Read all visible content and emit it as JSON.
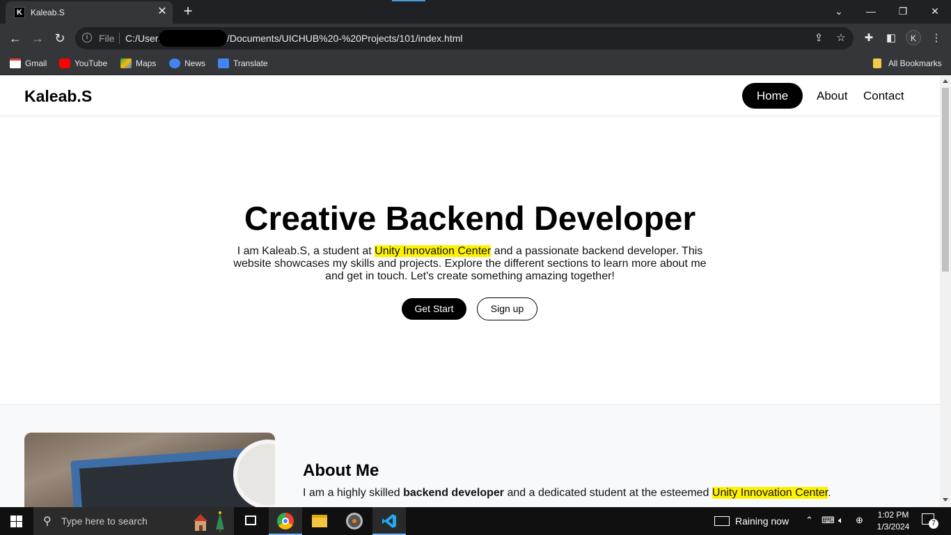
{
  "browser": {
    "tab_title": "Kaleab.S",
    "tab_favicon_letter": "K",
    "address": {
      "scheme_label": "File",
      "url_prefix": "C:/Users",
      "url_suffix": "/Documents/UICHUB%20-%20Projects/101/index.html"
    },
    "profile_initial": "K",
    "bookmarks": [
      {
        "label": "Gmail",
        "icon": "gmail-icon",
        "color": "#ea4335"
      },
      {
        "label": "YouTube",
        "icon": "youtube-icon",
        "color": "#ff0000"
      },
      {
        "label": "Maps",
        "icon": "maps-icon",
        "color": "#34a853"
      },
      {
        "label": "News",
        "icon": "news-icon",
        "color": "#4285f4"
      },
      {
        "label": "Translate",
        "icon": "translate-icon",
        "color": "#4285f4"
      }
    ],
    "all_bookmarks_label": "All Bookmarks"
  },
  "site": {
    "logo": "Kaleab.S",
    "nav": {
      "home": "Home",
      "about": "About",
      "contact": "Contact"
    },
    "hero": {
      "title": "Creative Backend Developer",
      "text_before": "I am Kaleab.S, a student at ",
      "highlight": "Unity Innovation Center",
      "text_after": " and a passionate backend developer. This website showcases my skills and projects. Explore the different sections to learn more about me and get in touch. Let's create something amazing together!",
      "primary_button": "Get Start",
      "secondary_button": "Sign up"
    },
    "about": {
      "title": "About Me",
      "text_before": "I am a highly skilled ",
      "bold": "backend developer",
      "text_middle": " and a dedicated student at the esteemed ",
      "highlight": "Unity Innovation Center",
      "text_after": "."
    }
  },
  "taskbar": {
    "search_placeholder": "Type here to search",
    "weather": "Raining now",
    "time": "1:02 PM",
    "date": "1/3/2024",
    "notification_count": "7",
    "accent": "#7ab7ff"
  }
}
